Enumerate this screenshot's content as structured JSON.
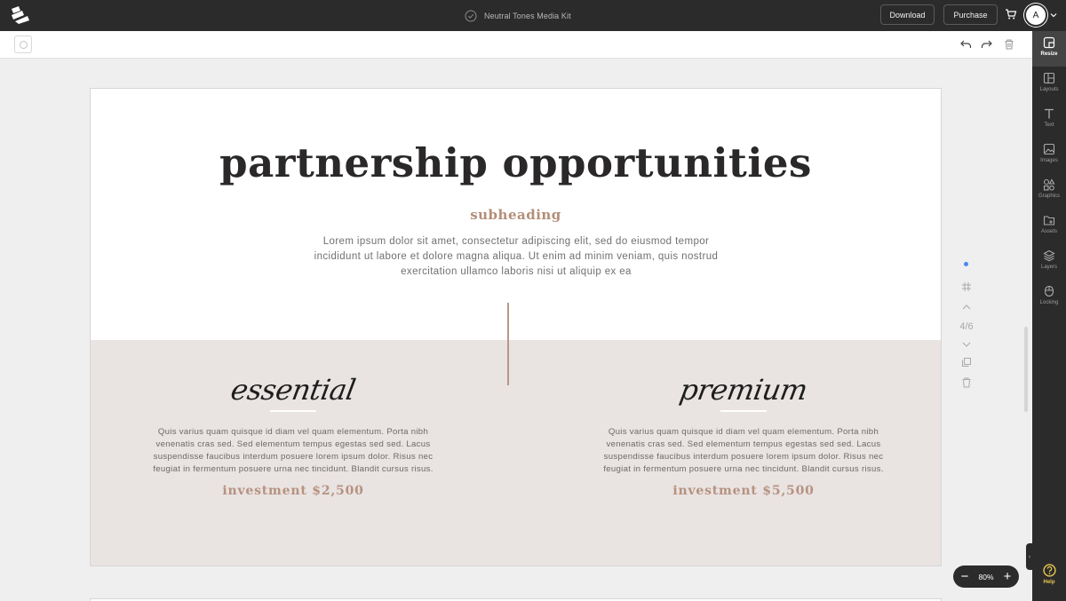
{
  "topbar": {
    "document_title": "Neutral Tones Media Kit",
    "download_label": "Download",
    "purchase_label": "Purchase",
    "avatar_initial": "A"
  },
  "sidebar": {
    "items": [
      {
        "label": "Resize",
        "icon": "resize-icon",
        "active": true
      },
      {
        "label": "Layouts",
        "icon": "layouts-icon"
      },
      {
        "label": "Text",
        "icon": "text-icon"
      },
      {
        "label": "Images",
        "icon": "images-icon"
      },
      {
        "label": "Graphics",
        "icon": "graphics-icon"
      },
      {
        "label": "Assets",
        "icon": "assets-icon"
      },
      {
        "label": "Layers",
        "icon": "layers-icon"
      },
      {
        "label": "Locking",
        "icon": "locking-icon"
      }
    ],
    "help_label": "Help"
  },
  "canvas": {
    "title": "partnership opportunities",
    "subheading": "subheading",
    "intro": "Lorem ipsum dolor sit amet, consectetur adipiscing elit, sed do eiusmod tempor incididunt ut labore et dolore magna aliqua. Ut enim ad minim veniam, quis nostrud exercitation ullamco laboris nisi ut aliquip ex ea",
    "packages": [
      {
        "name": "essential",
        "body": "Quis varius quam quisque id diam vel quam elementum. Porta nibh venenatis cras sed. Sed elementum tempus egestas sed sed. Lacus suspendisse faucibus interdum posuere lorem ipsum dolor. Risus nec feugiat in fermentum posuere urna nec tincidunt. Blandit cursus risus.",
        "price": "investment $2,500"
      },
      {
        "name": "premium",
        "body": "Quis varius quam quisque id diam vel quam elementum. Porta nibh venenatis cras sed. Sed elementum tempus egestas sed sed. Lacus suspendisse faucibus interdum posuere lorem ipsum dolor. Risus nec feugiat in fermentum posuere urna nec tincidunt. Blandit cursus risus.",
        "price": "investment $5,500"
      }
    ]
  },
  "page_controls": {
    "counter": "4/6"
  },
  "zoom": {
    "level": "80%",
    "minus": "−",
    "plus": "+"
  },
  "colors": {
    "accent": "#b38e78",
    "beige": "#e9e3e1",
    "dark": "#2b2b2b",
    "help": "#e8c850",
    "dot": "#4a87f5"
  }
}
